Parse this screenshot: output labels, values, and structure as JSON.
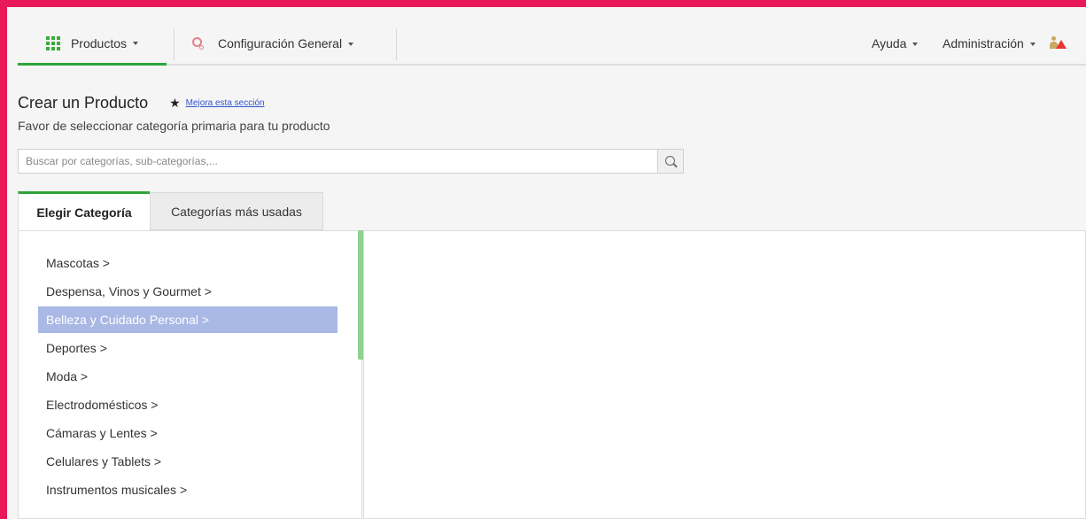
{
  "nav": {
    "products_label": "Productos",
    "config_label": "Configuración General",
    "help_label": "Ayuda",
    "admin_label": "Administración"
  },
  "header": {
    "title": "Crear un Producto",
    "improve_link": "Mejora esta sección",
    "subtitle": "Favor de seleccionar categoría primaria para tu producto"
  },
  "search": {
    "placeholder": "Buscar por categorías, sub-categorías,..."
  },
  "tabs": [
    {
      "label": "Elegir Categoría",
      "active": true
    },
    {
      "label": "Categorías más usadas",
      "active": false
    }
  ],
  "categories": [
    {
      "label": "Mascotas >"
    },
    {
      "label": "Despensa, Vinos y Gourmet >"
    },
    {
      "label": "Belleza y Cuidado Personal >",
      "selected": true
    },
    {
      "label": "Deportes >"
    },
    {
      "label": "Moda >"
    },
    {
      "label": "Electrodomésticos >"
    },
    {
      "label": "Cámaras y Lentes >"
    },
    {
      "label": "Celulares y Tablets >"
    },
    {
      "label": "Instrumentos musicales >"
    }
  ],
  "colors": {
    "accent_green": "#2ca53a",
    "selected_bg": "#a9b8e4",
    "border_pink": "#e8185a"
  }
}
